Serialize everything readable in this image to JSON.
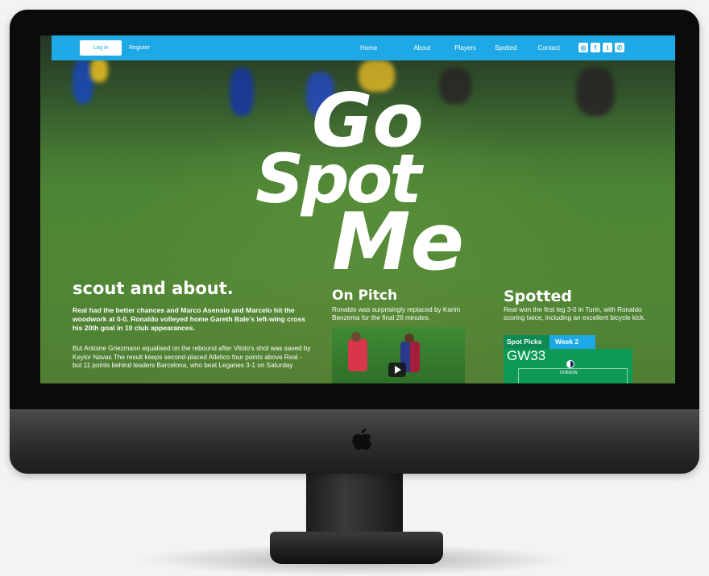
{
  "nav": {
    "login_label": "Log in",
    "register_label": "Register",
    "links": [
      "Home",
      "About",
      "Players",
      "Spotted",
      "Contact"
    ],
    "social_icons": [
      "instagram-icon",
      "facebook-icon",
      "twitter-icon",
      "whatsapp-icon"
    ]
  },
  "logo": {
    "line1": "Go",
    "line2": "Spot",
    "line3": "Me"
  },
  "scout": {
    "title": "scout and about.",
    "lead": "Real had the better chances and Marco Asensio and Marcelo hit the woodwork at 0-0. Ronaldo volleyed home Gareth Bale's left-wing cross his 20th goal in 10 club appearances.",
    "body": "But Antoine Griezmann equalised on the rebound after Vitolo's shot was saved by Keylor Navas The result keeps second-placed Atletico four points above Real - but 11 points behind leaders Barcelona, who beat Leganes 3-1 on Saturday"
  },
  "on_pitch": {
    "title": "On Pitch",
    "body": "Ronaldo was surprisingly replaced by Karim Benzema for the final 26 minutes."
  },
  "spotted": {
    "title": "Spotted",
    "body": "Real won the first leg 3-0 in Turin, with Ronaldo scoring twice, including an excellent bicycle kick.",
    "card_label": "Spot Picks",
    "week_label": "Week 2",
    "gameweek": "GW33",
    "player_name": "DOBSON"
  },
  "colors": {
    "nav_blue": "#1ea8e6",
    "pitch_green": "#0e9a55"
  }
}
